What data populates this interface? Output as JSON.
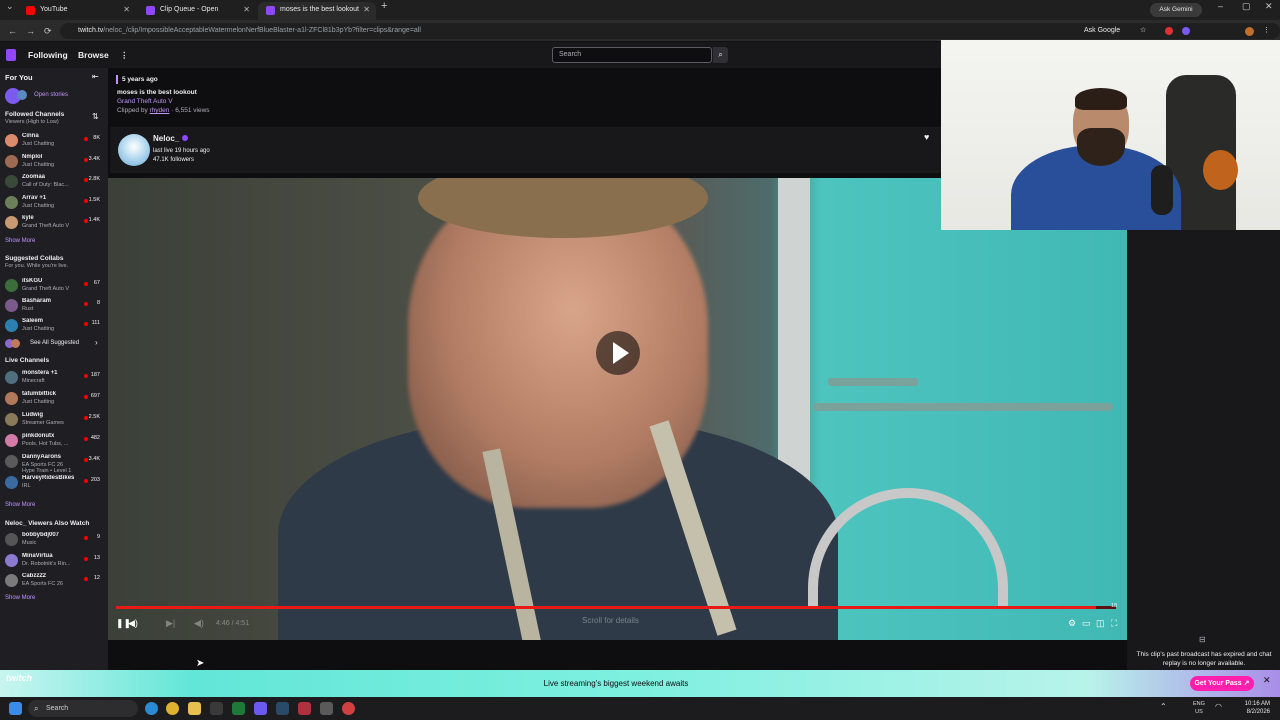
{
  "browser": {
    "tabs": [
      {
        "title": "YouTube",
        "color": "#ff0000"
      },
      {
        "title": "Clip Queue - Open",
        "color": "#9147ff"
      },
      {
        "title": "moses is the best lookout",
        "color": "#9147ff"
      }
    ],
    "url_domain": "twitch.tv",
    "url_path": "/neloc_/clip/ImpossibleAcceptableWatermelonNerfBlueBlaster-a1l-ZFCl81b3pYb?filter=clips&range=all",
    "ask_google": "Ask Google",
    "ask_gemini": "Ask Gemini"
  },
  "topnav": {
    "following": "Following",
    "browse": "Browse",
    "search_placeholder": "Search"
  },
  "sidebar": {
    "for_you": "For You",
    "open_stories": "Open stories",
    "followed_title": "Followed Channels",
    "followed_sort": "Viewers (High to Low)",
    "followed": [
      {
        "name": "Cinna",
        "game": "Just Chatting",
        "viewers": "8K",
        "color": "#d98b6b"
      },
      {
        "name": "Nmplol",
        "game": "Just Chatting",
        "viewers": "3.4K",
        "color": "#9e6b52"
      },
      {
        "name": "Zoomaa",
        "game": "Call of Duty: Blac...",
        "viewers": "2.8K",
        "color": "#3a4a3a"
      },
      {
        "name": "Arrav +1",
        "game": "Just Chatting",
        "viewers": "1.5K",
        "color": "#6b7f5a"
      },
      {
        "name": "kyle",
        "game": "Grand Theft Auto V",
        "viewers": "1.4K",
        "color": "#c99a72"
      }
    ],
    "show_more": "Show More",
    "collab_title": "Suggested Collabs",
    "collab_sub": "For you. While you're live.",
    "collabs": [
      {
        "name": "itsKGU",
        "game": "Grand Theft Auto V",
        "viewers": "67",
        "color": "#3c6e3c"
      },
      {
        "name": "Basharam",
        "game": "Rust",
        "viewers": "8",
        "color": "#7a5a8a"
      },
      {
        "name": "Saleem",
        "game": "Just Chatting",
        "viewers": "111",
        "color": "#2d7fb0"
      }
    ],
    "see_all": "See All Suggested",
    "live_title": "Live Channels",
    "live": [
      {
        "name": "monstera +1",
        "game": "Minecraft",
        "viewers": "187",
        "color": "#4f6f7f"
      },
      {
        "name": "tatumbittick",
        "game": "Just Chatting",
        "viewers": "697",
        "color": "#b07a5a"
      },
      {
        "name": "Ludwig",
        "game": "Streamer Games",
        "viewers": "2.5K",
        "color": "#8a7a5a"
      },
      {
        "name": "pinkdonutx",
        "game": "Pools, Hot Tubs, ...",
        "viewers": "482",
        "color": "#d27aa8"
      },
      {
        "name": "DannyAarons",
        "game": "EA Sports FC 26",
        "viewers": "3.4K",
        "color": "#5a5a5a"
      },
      {
        "name": "HarveyRidesBikes",
        "game": "IRL",
        "viewers": "203",
        "color": "#3a6aa0"
      }
    ],
    "hype_train": "Hype Train • Level 1",
    "also_title": "Neloc_ Viewers Also Watch",
    "also": [
      {
        "name": "bobbybdj007",
        "game": "Music",
        "viewers": "9",
        "color": "#555"
      },
      {
        "name": "MinaVirtua",
        "game": "Dr. Robotnik's Rin...",
        "viewers": "13",
        "color": "#8a7ad0"
      },
      {
        "name": "Cabzz22",
        "game": "EA Sports FC 26",
        "viewers": "12",
        "color": "#7a7a7a"
      }
    ]
  },
  "clip": {
    "age": "5 years ago",
    "title": "moses is the best lookout",
    "game": "Grand Theft Auto V",
    "clipped_by_prefix": "Clipped by",
    "clipper": "rhyden",
    "views": "· 6,551 views"
  },
  "streamer": {
    "name": "Neloc_",
    "last_live": "last live 19 hours ago",
    "followers": "47.1K followers"
  },
  "player": {
    "time": "4:46 / 4:51",
    "scroll_hint": "Scroll for details",
    "progress": 0.98,
    "end_time": "18"
  },
  "chat": {
    "expired_msg": "This clip's past broadcast has expired and chat replay is no longer available."
  },
  "banner": {
    "logo": "twitch",
    "text": "Live streaming's biggest weekend awaits",
    "button": "Get Your Pass ↗"
  },
  "taskbar": {
    "search": "Search",
    "lang": "ENG",
    "region": "US",
    "time": "10:16 AM",
    "date": "8/2/2026"
  }
}
